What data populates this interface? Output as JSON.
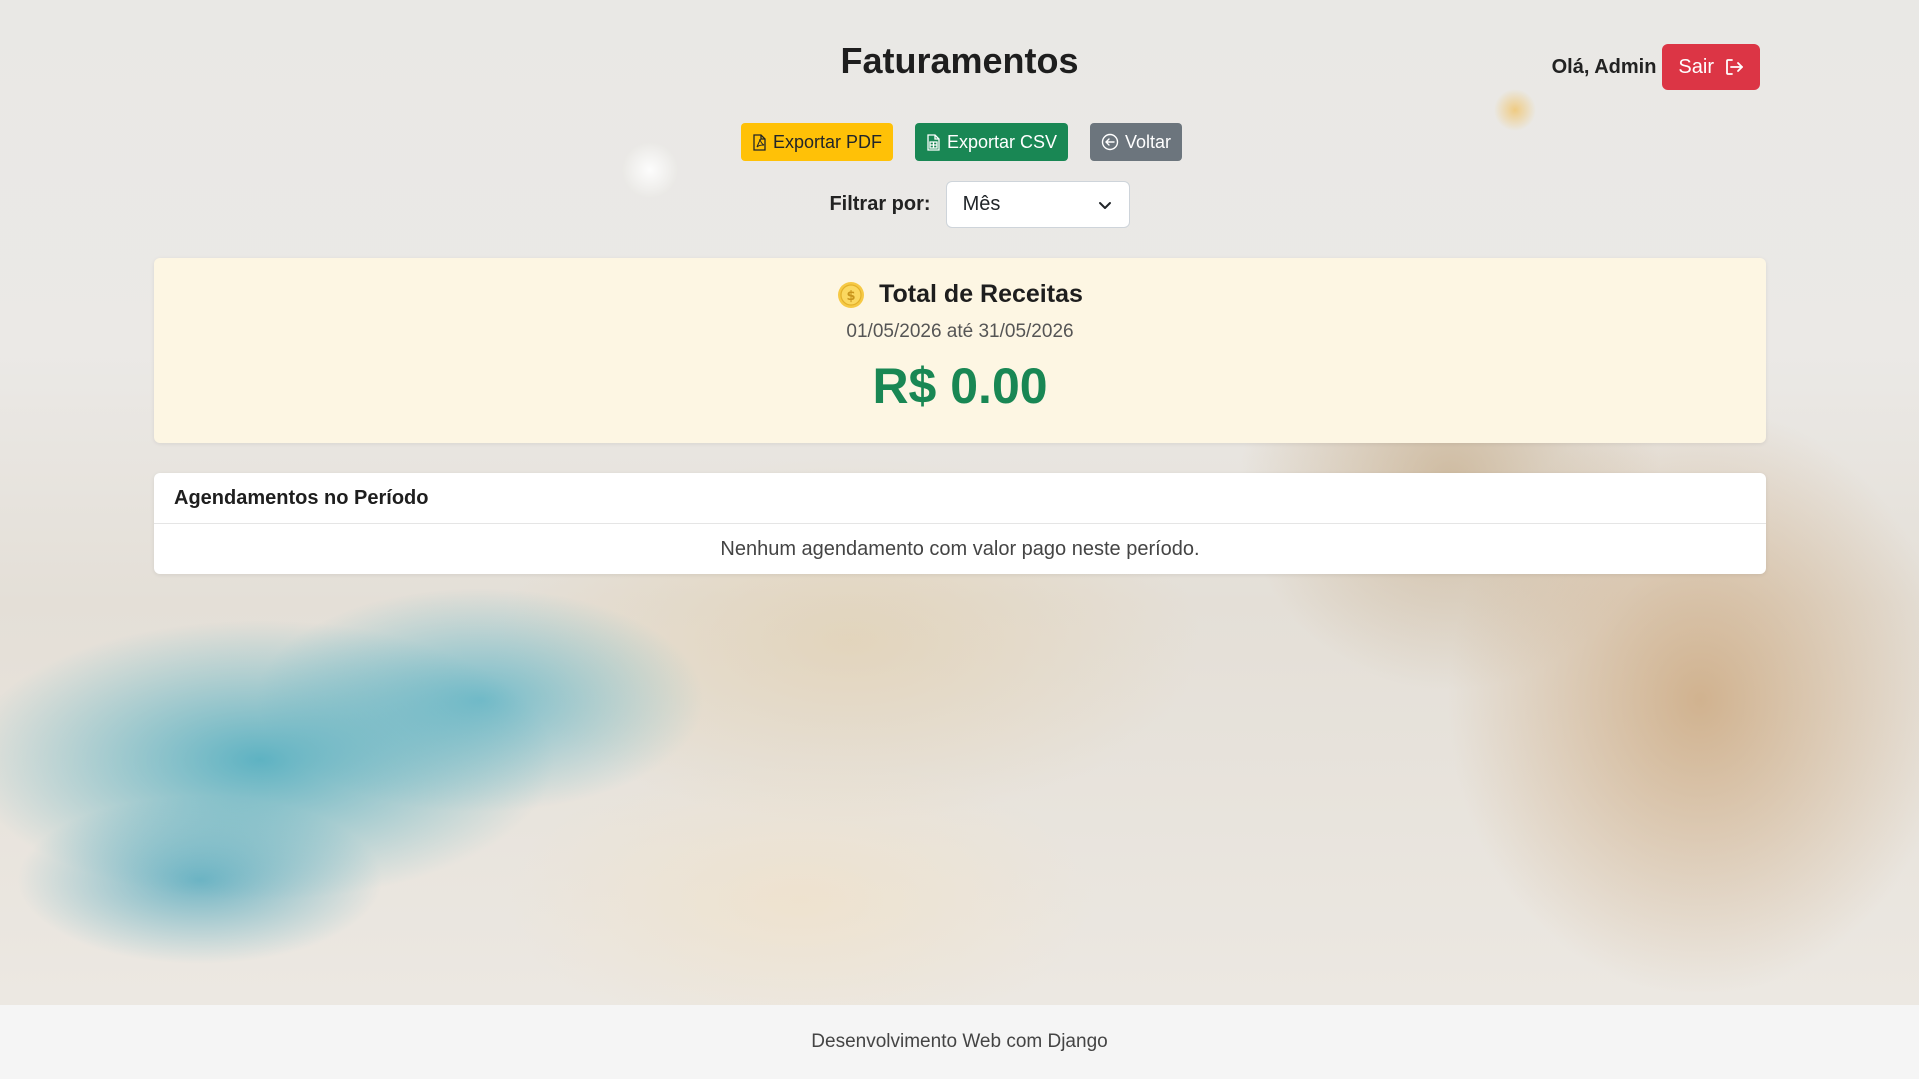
{
  "header": {
    "title": "Faturamentos",
    "greeting": "Olá, Admin",
    "logout_label": "Sair"
  },
  "toolbar": {
    "export_pdf_label": "Exportar PDF",
    "export_csv_label": "Exportar CSV",
    "back_label": "Voltar"
  },
  "filter": {
    "label": "Filtrar por:",
    "selected": "Mês"
  },
  "total_card": {
    "title": "Total de Receitas",
    "period": "01/05/2026 até 31/05/2026",
    "value": "R$ 0.00",
    "icon": "coin-icon"
  },
  "appointments": {
    "title": "Agendamentos no Período",
    "empty_message": "Nenhum agendamento com valor pago neste período."
  },
  "footer": {
    "text": "Desenvolvimento Web com Django"
  },
  "colors": {
    "danger": "#dc3545",
    "warning": "#ffc107",
    "success": "#198754",
    "secondary": "#6c757d",
    "card_bg": "#fdf6e3"
  }
}
